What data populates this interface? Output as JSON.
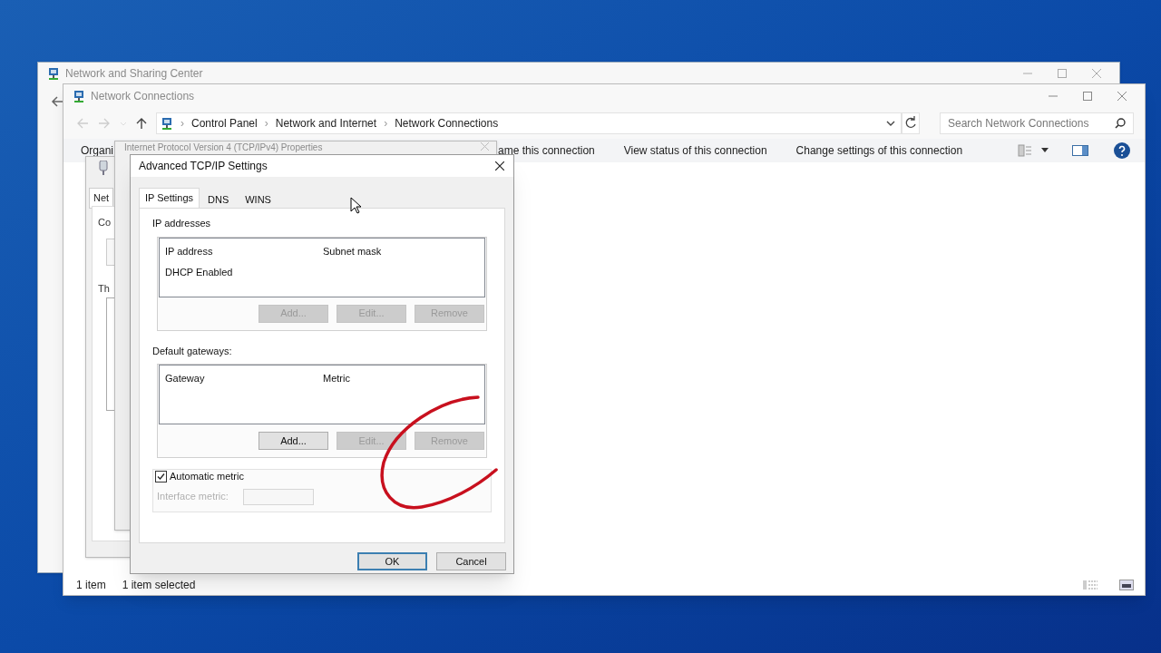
{
  "background_window": {
    "title": "Network and Sharing Center"
  },
  "explorer": {
    "title": "Network Connections",
    "breadcrumb": [
      "Control Panel",
      "Network and Internet",
      "Network Connections"
    ],
    "breadcrumb_separator": "›",
    "search": {
      "placeholder": "Search Network Connections"
    },
    "toolbar": [
      "Organi",
      "ame this connection",
      "View status of this connection",
      "Change settings of this connection"
    ],
    "status_bar": [
      "1 item",
      "1 item selected"
    ]
  },
  "adapter_dialog": {
    "fragments": [
      "Net",
      "Co",
      "Th"
    ]
  },
  "ipv4_dialog": {
    "title": "Internet Protocol Version 4 (TCP/IPv4) Properties"
  },
  "dialog": {
    "title": "Advanced TCP/IP Settings",
    "tabs": [
      {
        "label": "IP Settings",
        "selected": true
      },
      {
        "label": "DNS",
        "selected": false
      },
      {
        "label": "WINS",
        "selected": false
      }
    ],
    "ip_addresses": {
      "label": "IP addresses",
      "columns": [
        "IP address",
        "Subnet mask"
      ],
      "rows": [
        [
          "DHCP Enabled"
        ]
      ],
      "buttons": [
        {
          "label": "Add...",
          "disabled": true
        },
        {
          "label": "Edit...",
          "disabled": true
        },
        {
          "label": "Remove",
          "disabled": true
        }
      ]
    },
    "gateways": {
      "label": "Default gateways:",
      "columns": [
        "Gateway",
        "Metric"
      ],
      "buttons": [
        {
          "label": "Add...",
          "disabled": false
        },
        {
          "label": "Edit...",
          "disabled": true
        },
        {
          "label": "Remove",
          "disabled": true
        }
      ]
    },
    "automatic_metric": {
      "label": "Automatic metric",
      "checked": true
    },
    "interface_metric": {
      "label": "Interface metric:",
      "disabled": true
    },
    "footer_buttons": [
      {
        "label": "OK",
        "default": true
      },
      {
        "label": "Cancel",
        "default": false
      }
    ]
  }
}
